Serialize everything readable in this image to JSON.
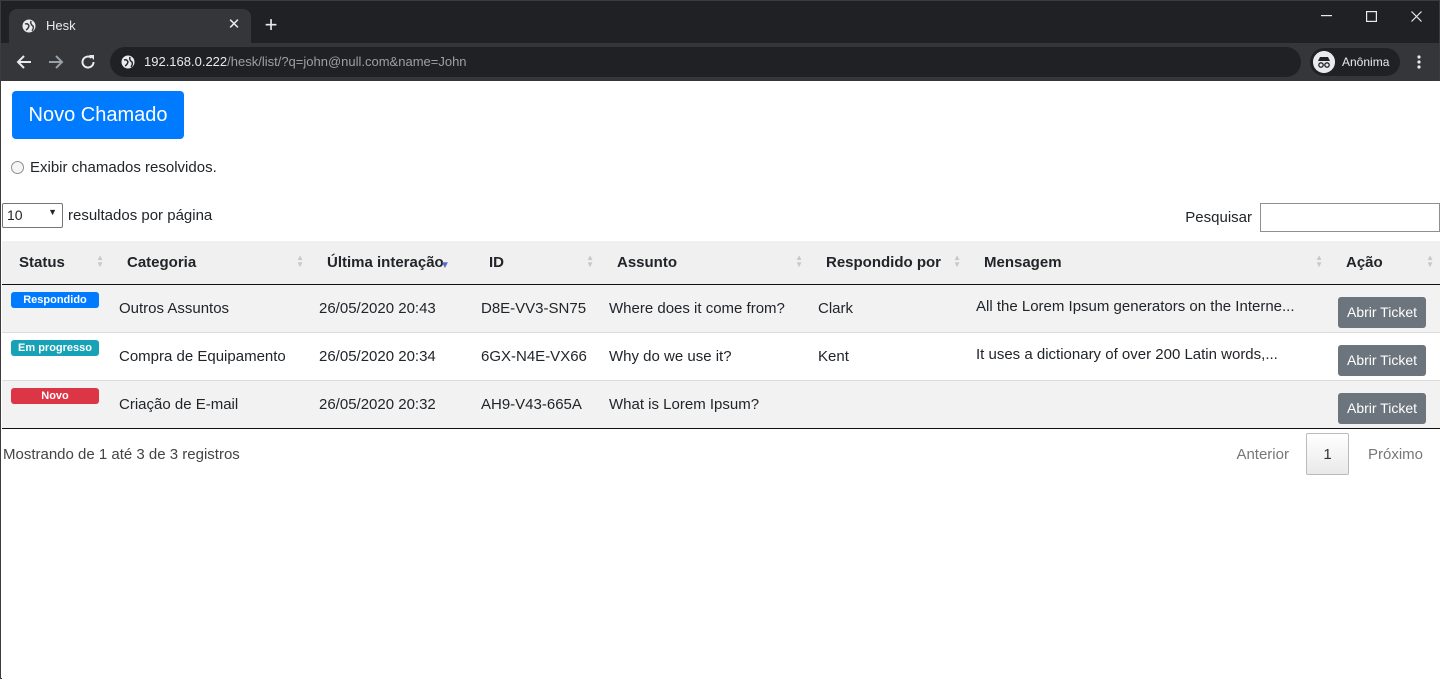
{
  "browser": {
    "tab_title": "Hesk",
    "url_host": "192.168.0.222",
    "url_path": "/hesk/list/?q=john@null.com&name=John",
    "profile_label": "Anônima"
  },
  "page": {
    "new_ticket_label": "Novo Chamado",
    "show_resolved_label": "Exibir chamados resolvidos.",
    "page_length_value": "10",
    "page_length_suffix": "resultados por página",
    "search_label": "Pesquisar",
    "search_value": ""
  },
  "table": {
    "headers": [
      "Status",
      "Categoria",
      "Última interação",
      "ID",
      "Assunto",
      "Respondido por",
      "Mensagem",
      "Ação"
    ],
    "rows": [
      {
        "status": "Respondido",
        "status_color": "#007bff",
        "categoria": "Outros Assuntos",
        "data": "26/05/2020 20:43",
        "id": "D8E-VV3-SN75",
        "assunto": "Where does it come from?",
        "respondido": "Clark",
        "mensagem": "All the Lorem Ipsum generators on the Interne...",
        "acao": "Abrir Ticket"
      },
      {
        "status": "Em progresso",
        "status_color": "#17a2b8",
        "categoria": "Compra de Equipamento",
        "data": "26/05/2020 20:34",
        "id": "6GX-N4E-VX66",
        "assunto": "Why do we use it?",
        "respondido": "Kent",
        "mensagem": "It uses a dictionary of over 200 Latin words,...",
        "acao": "Abrir Ticket"
      },
      {
        "status": "Novo",
        "status_color": "#dc3545",
        "categoria": "Criação de E-mail",
        "data": "26/05/2020 20:32",
        "id": "AH9-V43-665A",
        "assunto": "What is Lorem Ipsum?",
        "respondido": "",
        "mensagem": "",
        "acao": "Abrir Ticket"
      }
    ]
  },
  "footer": {
    "info": "Mostrando de 1 até 3 de 3 registros",
    "prev_label": "Anterior",
    "current_page": "1",
    "next_label": "Próximo"
  }
}
